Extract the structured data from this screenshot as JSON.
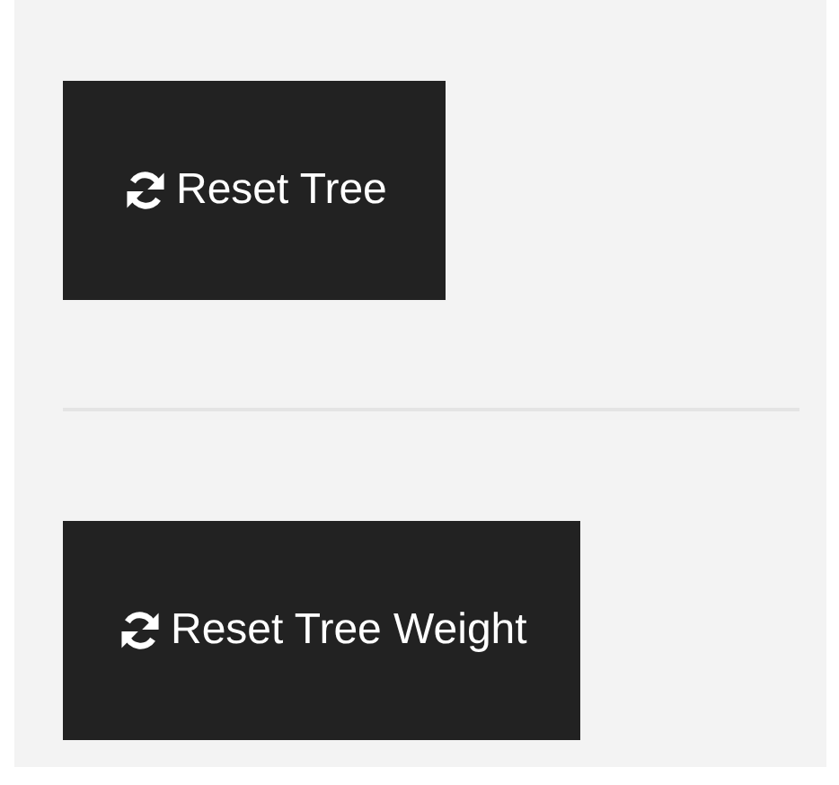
{
  "buttons": [
    {
      "label": "Reset Tree"
    },
    {
      "label": "Reset Tree Weight"
    }
  ]
}
